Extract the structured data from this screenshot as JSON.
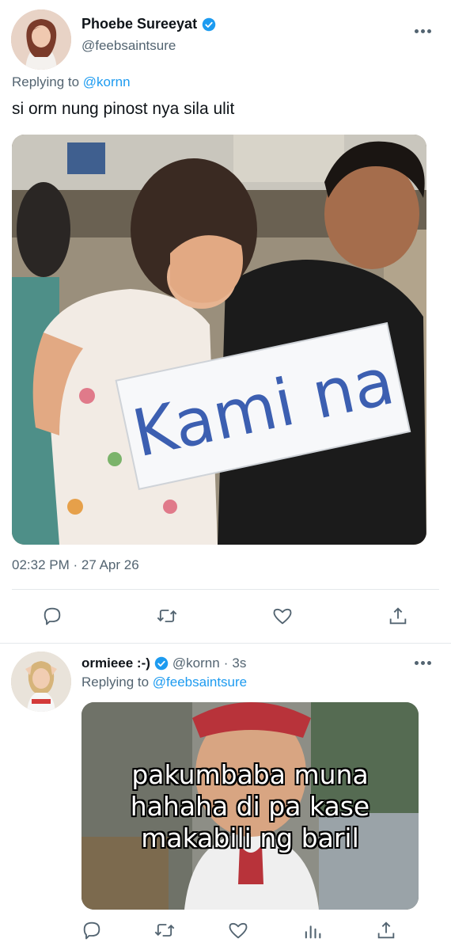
{
  "main_tweet": {
    "display_name": "Phoebe Sureeyat",
    "handle": "@feebsaintsure",
    "replying_prefix": "Replying to",
    "replying_to": "@kornn",
    "text": "si orm nung pinost nya sila ulit",
    "image_sign_text": "Kami na",
    "timestamp": "02:32 PM · 27 Apr 26",
    "icons": [
      "reply-icon",
      "retweet-icon",
      "like-icon",
      "share-icon"
    ]
  },
  "reply_tweet": {
    "display_name": "ormieee :-)",
    "handle": "@kornn",
    "separator": "·",
    "time": "3s",
    "replying_prefix": "Replying to",
    "replying_to": "@feebsaintsure",
    "meme_caption": [
      "pakumbaba muna",
      "hahaha di pa kase",
      "makabili ng baril"
    ],
    "icons": [
      "reply-icon",
      "retweet-icon",
      "like-icon",
      "analytics-icon",
      "share-icon"
    ]
  },
  "colors": {
    "accent": "#1d9bf0",
    "secondary_text": "#536471",
    "primary_text": "#0f1419",
    "divider": "#e4e8eb"
  }
}
